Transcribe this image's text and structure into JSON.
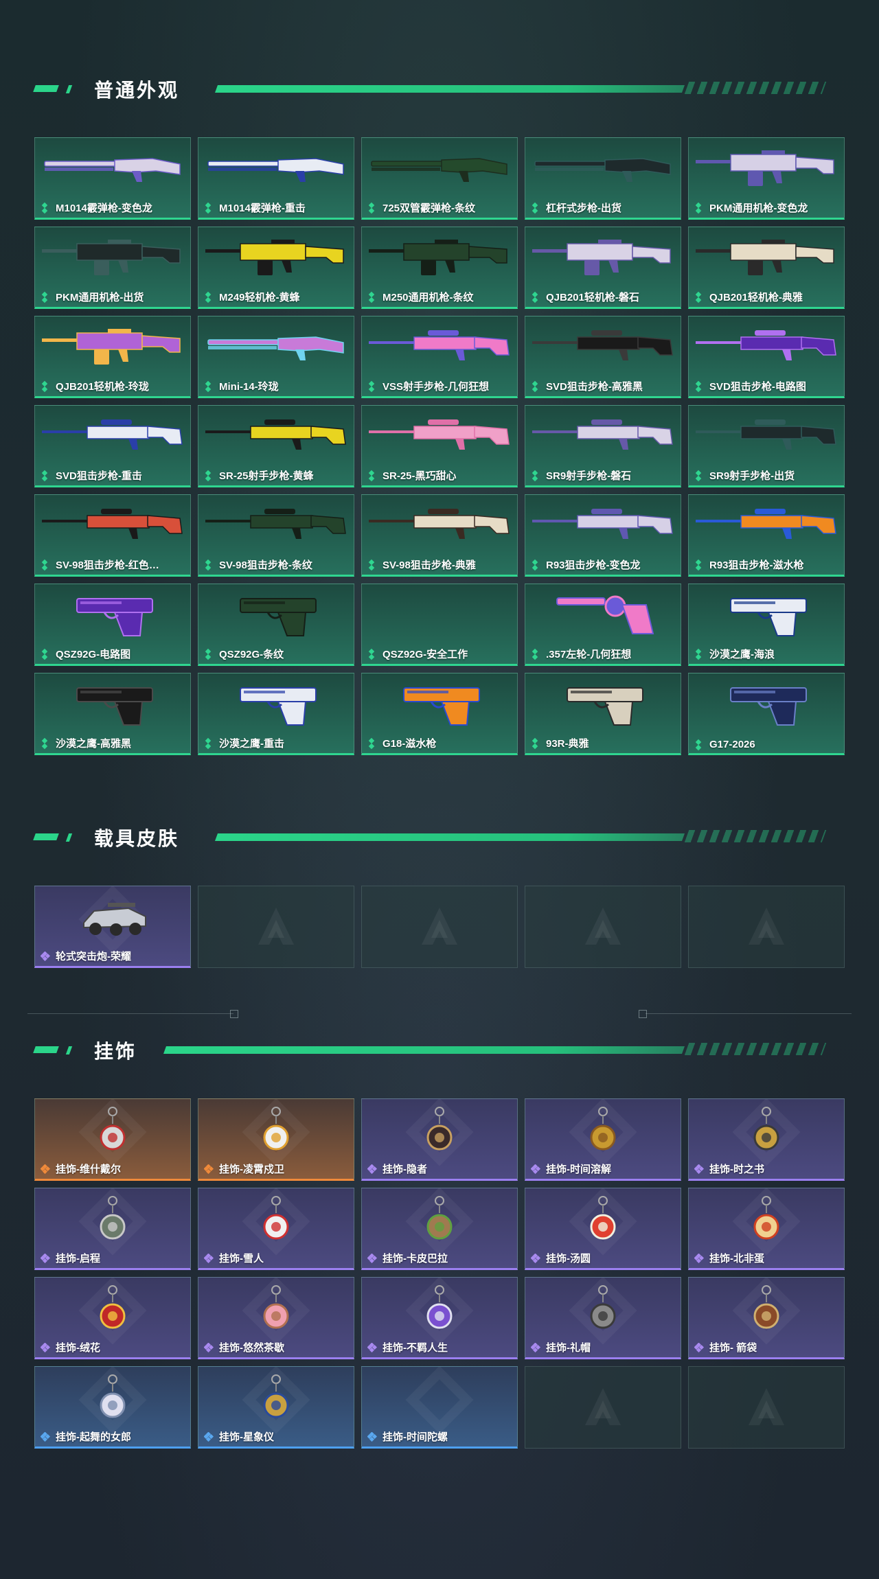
{
  "sections": [
    {
      "title": "普通外观",
      "items": [
        {
          "label": "M1014霰弹枪-变色龙",
          "rarity": "green",
          "gun": "shotgun",
          "color": "#d9d2e6",
          "accent": "#6d5cc8"
        },
        {
          "label": "M1014霰弹枪-重击",
          "rarity": "green",
          "gun": "shotgun",
          "color": "#e8ecf4",
          "accent": "#2a3fa8"
        },
        {
          "label": "725双管霰弹枪-条纹",
          "rarity": "green",
          "gun": "shotgun",
          "color": "#244a2c",
          "accent": "#1d2d1e"
        },
        {
          "label": "杠杆式步枪-出货",
          "rarity": "green",
          "gun": "rifle",
          "color": "#1e2a2c",
          "accent": "#2f5b5a"
        },
        {
          "label": "PKM通用机枪-变色龙",
          "rarity": "green",
          "gun": "mg",
          "color": "#d6d0e6",
          "accent": "#5f58b0"
        },
        {
          "label": "PKM通用机枪-出货",
          "rarity": "green",
          "gun": "mg",
          "color": "#1f2a2a",
          "accent": "#3a5e5c"
        },
        {
          "label": "M249轻机枪-黄蜂",
          "rarity": "green",
          "gun": "mg",
          "color": "#e8d420",
          "accent": "#1a1a1a"
        },
        {
          "label": "M250通用机枪-条纹",
          "rarity": "green",
          "gun": "mg",
          "color": "#24432b",
          "accent": "#151f17"
        },
        {
          "label": "QJB201轻机枪-磐石",
          "rarity": "green",
          "gun": "mg",
          "color": "#d9d3e6",
          "accent": "#6659a8"
        },
        {
          "label": "QJB201轻机枪-典雅",
          "rarity": "green",
          "gun": "mg",
          "color": "#e6dcc6",
          "accent": "#2a2a2a"
        },
        {
          "label": "QJB201轻机枪-玲珑",
          "rarity": "green",
          "gun": "mg",
          "color": "#b063d6",
          "accent": "#f2b64a"
        },
        {
          "label": "Mini-14-玲珑",
          "rarity": "green",
          "gun": "rifle",
          "color": "#c87ad8",
          "accent": "#6fd4f0"
        },
        {
          "label": "VSS射手步枪-几何狂想",
          "rarity": "green",
          "gun": "sniper",
          "color": "#f07ac8",
          "accent": "#6a5ad8"
        },
        {
          "label": "SVD狙击步枪-高雅黑",
          "rarity": "green",
          "gun": "sniper",
          "color": "#1a1a1a",
          "accent": "#3a3a3a"
        },
        {
          "label": "SVD狙击步枪-电路图",
          "rarity": "green",
          "gun": "sniper",
          "color": "#5a2bb0",
          "accent": "#b070f0"
        },
        {
          "label": "SVD狙击步枪-重击",
          "rarity": "green",
          "gun": "sniper",
          "color": "#e8ecf4",
          "accent": "#2a3fa8"
        },
        {
          "label": "SR-25射手步枪-黄蜂",
          "rarity": "green",
          "gun": "sniper",
          "color": "#e8d420",
          "accent": "#1a1a1a"
        },
        {
          "label": "SR-25-黑巧甜心",
          "rarity": "green",
          "gun": "sniper",
          "color": "#f0a0c8",
          "accent": "#e070a8"
        },
        {
          "label": "SR9射手步枪-磐石",
          "rarity": "green",
          "gun": "sniper",
          "color": "#d9d3e6",
          "accent": "#6659a8"
        },
        {
          "label": "SR9射手步枪-出货",
          "rarity": "green",
          "gun": "sniper",
          "color": "#1e2a2c",
          "accent": "#2f5b5a"
        },
        {
          "label": "SV-98狙击步枪-红色…",
          "rarity": "green",
          "gun": "sniper",
          "color": "#d8503a",
          "accent": "#1a1a1a"
        },
        {
          "label": "SV-98狙击步枪-条纹",
          "rarity": "green",
          "gun": "sniper",
          "color": "#24432b",
          "accent": "#151f17"
        },
        {
          "label": "SV-98狙击步枪-典雅",
          "rarity": "green",
          "gun": "sniper",
          "color": "#e6dcc6",
          "accent": "#3a2a22"
        },
        {
          "label": "R93狙击步枪-变色龙",
          "rarity": "green",
          "gun": "sniper",
          "color": "#d6d0e6",
          "accent": "#5f58b0"
        },
        {
          "label": "R93狙击步枪-滋水枪",
          "rarity": "green",
          "gun": "sniper",
          "color": "#f08a20",
          "accent": "#2a5ad8"
        },
        {
          "label": "QSZ92G-电路图",
          "rarity": "green",
          "gun": "pistol",
          "color": "#5a2bb0",
          "accent": "#b070f0"
        },
        {
          "label": "QSZ92G-条纹",
          "rarity": "green",
          "gun": "pistol",
          "color": "#24432b",
          "accent": "#151f17"
        },
        {
          "label": "QSZ92G-安全工作",
          "rarity": "green",
          "gun": "none",
          "color": "#2a6a58",
          "accent": "#2a6a58"
        },
        {
          "label": ".357左轮-几何狂想",
          "rarity": "green",
          "gun": "revolver",
          "color": "#f07ac8",
          "accent": "#6a5ad8"
        },
        {
          "label": "沙漠之鹰-海浪",
          "rarity": "green",
          "gun": "pistol",
          "color": "#e8ecf4",
          "accent": "#1a3a8a"
        },
        {
          "label": "沙漠之鹰-高雅黑",
          "rarity": "green",
          "gun": "pistol",
          "color": "#1a1a1a",
          "accent": "#4a4a4a"
        },
        {
          "label": "沙漠之鹰-重击",
          "rarity": "green",
          "gun": "pistol",
          "color": "#e8ecf4",
          "accent": "#2a3fa8"
        },
        {
          "label": "G18-滋水枪",
          "rarity": "green",
          "gun": "pistol",
          "color": "#f08a20",
          "accent": "#2a4ad0"
        },
        {
          "label": "93R-典雅",
          "rarity": "green",
          "gun": "pistol",
          "color": "#d8d0be",
          "accent": "#2a2a2a"
        },
        {
          "label": "G17-2026",
          "rarity": "green",
          "gun": "pistol",
          "color": "#1e2a5a",
          "accent": "#6a80c8"
        }
      ]
    },
    {
      "title": "载具皮肤",
      "items": [
        {
          "label": "轮式突击炮-荣耀",
          "rarity": "purple",
          "gun": "vehicle",
          "color": "#c8ccd4",
          "accent": "#2a2a2a"
        },
        {
          "label": "",
          "rarity": "empty"
        },
        {
          "label": "",
          "rarity": "empty"
        },
        {
          "label": "",
          "rarity": "empty"
        },
        {
          "label": "",
          "rarity": "empty"
        }
      ]
    },
    {
      "title": "挂饰",
      "items": [
        {
          "label": "挂饰-维什戴尔",
          "rarity": "orange",
          "color": "#d8d8d8",
          "accent": "#c03030"
        },
        {
          "label": "挂饰-凌霄戍卫",
          "rarity": "orange",
          "color": "#f0f0f0",
          "accent": "#e0a030"
        },
        {
          "label": "挂饰-隐者",
          "rarity": "purple",
          "color": "#3a2a2a",
          "accent": "#c8a060"
        },
        {
          "label": "挂饰-时间溶解",
          "rarity": "purple",
          "color": "#c89a30",
          "accent": "#8a5a20"
        },
        {
          "label": "挂饰-时之书",
          "rarity": "purple",
          "color": "#c8a040",
          "accent": "#3a3a3a"
        },
        {
          "label": "挂饰-启程",
          "rarity": "purple",
          "color": "#6a7a6a",
          "accent": "#c8c8c8"
        },
        {
          "label": "挂饰-雪人",
          "rarity": "purple",
          "color": "#f0f0f0",
          "accent": "#d03030"
        },
        {
          "label": "挂饰-卡皮巴拉",
          "rarity": "purple",
          "color": "#a07a50",
          "accent": "#60a040"
        },
        {
          "label": "挂饰-汤圆",
          "rarity": "purple",
          "color": "#e04030",
          "accent": "#f0f0e0"
        },
        {
          "label": "挂饰-北非蛋",
          "rarity": "purple",
          "color": "#f0d090",
          "accent": "#d04020"
        },
        {
          "label": "挂饰-绒花",
          "rarity": "purple",
          "color": "#c02828",
          "accent": "#f0c040"
        },
        {
          "label": "挂饰-悠然茶歇",
          "rarity": "purple",
          "color": "#f0a0b0",
          "accent": "#b07050"
        },
        {
          "label": "挂饰-不羁人生",
          "rarity": "purple",
          "color": "#7a50d0",
          "accent": "#e0e0f0"
        },
        {
          "label": "挂饰-礼帽",
          "rarity": "purple",
          "color": "#8a8a8a",
          "accent": "#3a3a3a"
        },
        {
          "label": "挂饰- 箭袋",
          "rarity": "purple",
          "color": "#8a4a28",
          "accent": "#d0b070"
        },
        {
          "label": "挂饰-起舞的女郎",
          "rarity": "blue",
          "color": "#e0e0f0",
          "accent": "#8090b0"
        },
        {
          "label": "挂饰-星象仪",
          "rarity": "blue",
          "color": "#c8a040",
          "accent": "#2a4a9a"
        },
        {
          "label": "挂饰-时间陀螺",
          "rarity": "blue",
          "color": "",
          "accent": ""
        },
        {
          "label": "",
          "rarity": "empty"
        },
        {
          "label": "",
          "rarity": "empty"
        }
      ]
    }
  ]
}
